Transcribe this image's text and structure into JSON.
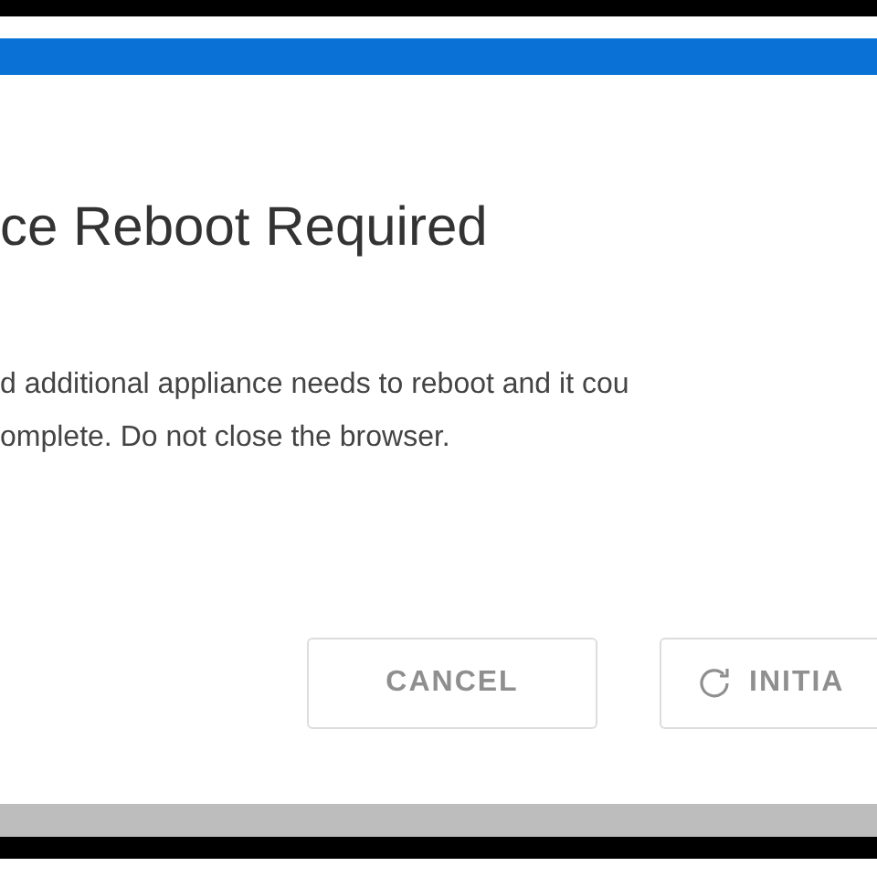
{
  "dialog": {
    "title": "ce Reboot Required",
    "message_lines": [
      "d additional appliance needs to reboot and it cou",
      "omplete. Do not close the browser."
    ],
    "buttons": [
      {
        "kind": "cancel",
        "label": "CANCEL",
        "disabled": true
      },
      {
        "kind": "initiate",
        "label": "INITIA",
        "disabled": true
      }
    ]
  }
}
